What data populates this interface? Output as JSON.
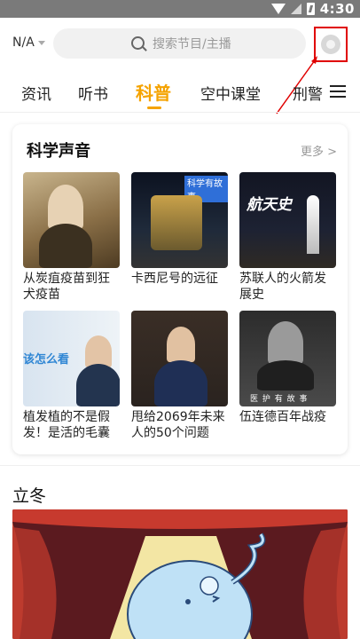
{
  "status_bar": {
    "time": "4:30"
  },
  "header": {
    "region": "N/A",
    "search_placeholder": "搜索节目/主播"
  },
  "tabs": [
    "资讯",
    "听书",
    "科普",
    "空中课堂",
    "刑警"
  ],
  "active_tab": "科普",
  "section": {
    "title": "科学声音",
    "more": "更多 >",
    "items": [
      {
        "caption": "从炭疽疫苗到狂犬疫苗"
      },
      {
        "caption": "卡西尼号的远征",
        "thumb_text": "科学有故事"
      },
      {
        "caption": "苏联人的火箭发展史",
        "thumb_text": "航天史"
      },
      {
        "caption": "植发植的不是假发！是活的毛囊",
        "thumb_text": "该怎么看"
      },
      {
        "caption": "甩给2069年未来人的50个问题"
      },
      {
        "caption": "伍连德百年战疫",
        "thumb_text": "医 护 有 故 事"
      }
    ]
  },
  "feature": {
    "title": "立冬"
  },
  "colors": {
    "accent": "#f5a300",
    "highlight_box": "#e00000"
  }
}
